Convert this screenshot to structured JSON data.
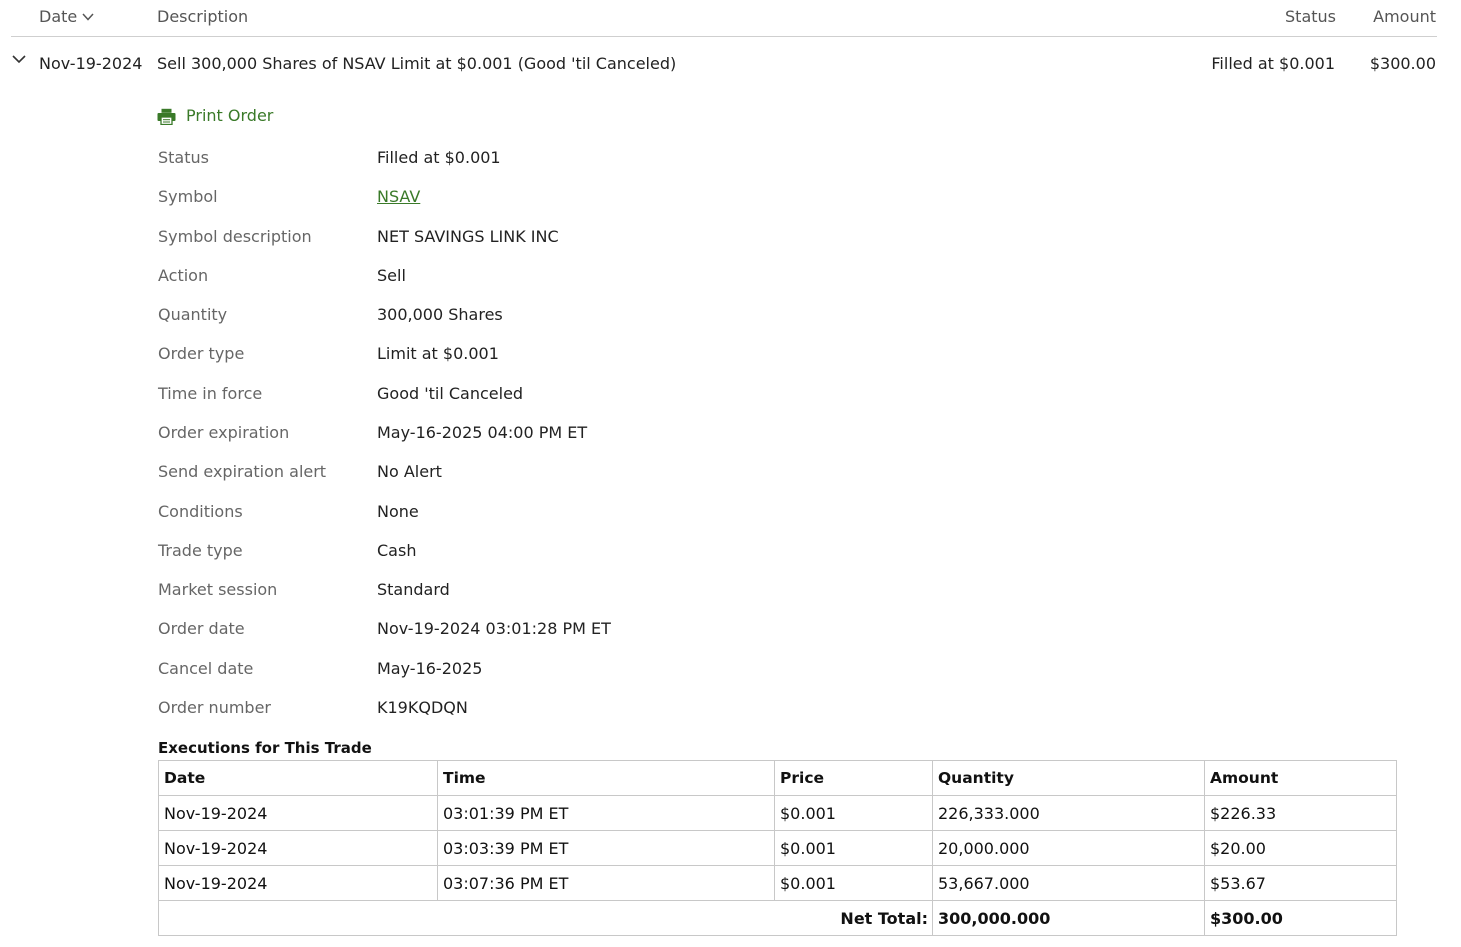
{
  "header": {
    "date": "Date",
    "description": "Description",
    "status": "Status",
    "amount": "Amount"
  },
  "order": {
    "date": "Nov-19-2024",
    "description": "Sell 300,000 Shares of NSAV Limit at $0.001 (Good 'til Canceled)",
    "status": "Filled at $0.001",
    "amount": "$300.00"
  },
  "print_label": "Print Order",
  "accent_color": "#3a7a29",
  "details": [
    {
      "label": "Status",
      "value": "Filled at $0.001"
    },
    {
      "label": "Symbol",
      "value": "NSAV"
    },
    {
      "label": "Symbol description",
      "value": "NET SAVINGS LINK INC"
    },
    {
      "label": "Action",
      "value": "Sell"
    },
    {
      "label": "Quantity",
      "value": "300,000 Shares"
    },
    {
      "label": "Order type",
      "value": "Limit at $0.001"
    },
    {
      "label": "Time in force",
      "value": "Good 'til Canceled"
    },
    {
      "label": "Order expiration",
      "value": "May-16-2025 04:00 PM ET"
    },
    {
      "label": "Send expiration alert",
      "value": "No Alert"
    },
    {
      "label": "Conditions",
      "value": "None"
    },
    {
      "label": "Trade type",
      "value": "Cash"
    },
    {
      "label": "Market session",
      "value": "Standard"
    },
    {
      "label": "Order date",
      "value": "Nov-19-2024 03:01:28 PM ET"
    },
    {
      "label": "Cancel date",
      "value": "May-16-2025"
    },
    {
      "label": "Order number",
      "value": "K19KQDQN"
    }
  ],
  "executions": {
    "title": "Executions for This Trade",
    "columns": [
      "Date",
      "Time",
      "Price",
      "Quantity",
      "Amount"
    ],
    "rows": [
      [
        "Nov-19-2024",
        "03:01:39 PM ET",
        "$0.001",
        "226,333.000",
        "$226.33"
      ],
      [
        "Nov-19-2024",
        "03:03:39 PM ET",
        "$0.001",
        "20,000.000",
        "$20.00"
      ],
      [
        "Nov-19-2024",
        "03:07:36 PM ET",
        "$0.001",
        "53,667.000",
        "$53.67"
      ]
    ],
    "total_label": "Net Total:",
    "total_quantity": "300,000.000",
    "total_amount": "$300.00"
  }
}
